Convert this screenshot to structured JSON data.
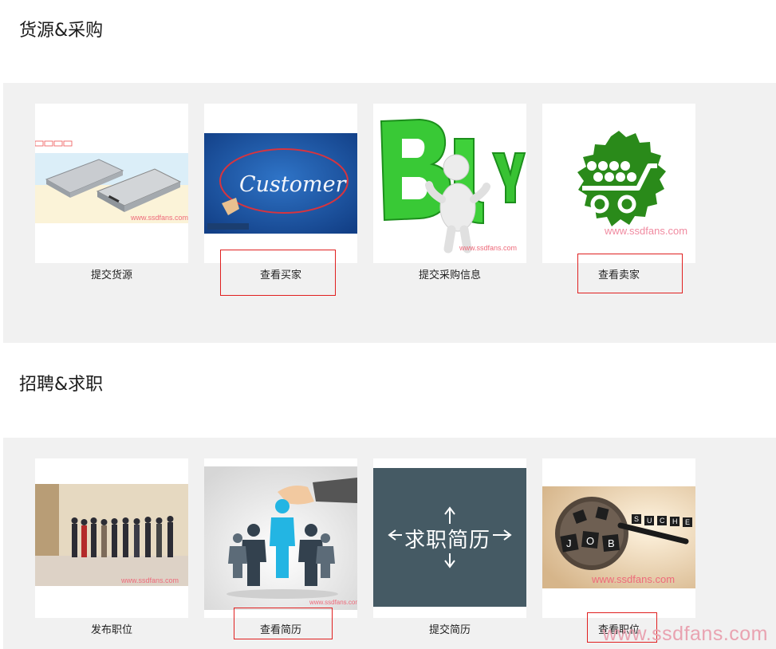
{
  "sections": [
    {
      "title": "货源&采购",
      "cards": [
        {
          "label": "提交货源",
          "icon": "ssd-drives-image"
        },
        {
          "label": "查看买家",
          "icon": "customer-image"
        },
        {
          "label": "提交采购信息",
          "icon": "buy-figure-image"
        },
        {
          "label": "查看卖家",
          "icon": "shopping-cart-seal-image"
        }
      ]
    },
    {
      "title": "招聘&求职",
      "cards": [
        {
          "label": "发布职位",
          "icon": "people-queue-image"
        },
        {
          "label": "查看简历",
          "icon": "hand-picking-person-image"
        },
        {
          "label": "提交简历",
          "icon": "resume-arrows-image"
        },
        {
          "label": "查看职位",
          "icon": "magnifier-job-image"
        }
      ]
    }
  ],
  "images": {
    "customer_text": "Customer",
    "resume_text": "求职简历",
    "image_watermark": "www.ssdfans.com",
    "job_letters": [
      "J",
      "O",
      "B"
    ],
    "search_letters": [
      "S",
      "U",
      "C",
      "H",
      "E"
    ]
  },
  "page_watermark": "www.ssdfans.com",
  "colors": {
    "band_bg": "#f1f1f1",
    "highlight": "#e02020",
    "resume_bg": "#455a64",
    "cart_green": "#2a8a1a",
    "buy_green": "#3fc43a"
  }
}
